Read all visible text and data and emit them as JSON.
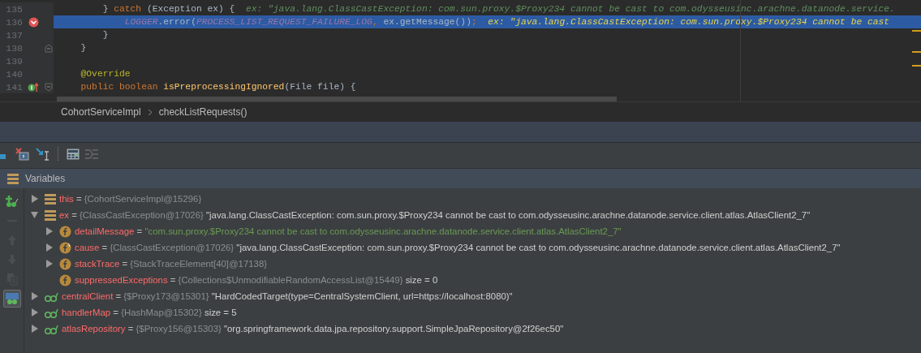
{
  "editor": {
    "lines": [
      {
        "number": "135",
        "kind": "code",
        "breakpoint": false,
        "selected": false,
        "tokens": [
          {
            "text": "      } ",
            "kind": "plain"
          },
          {
            "text": "catch",
            "kind": "keyword"
          },
          {
            "text": " (Exception ex) {",
            "kind": "plain"
          },
          {
            "text": "  ex: \"java.lang.ClassCastException: com.sun.proxy.$Proxy234 cannot be cast to com.odysseusinc.arachne.datanode.service.",
            "kind": "hint"
          }
        ]
      },
      {
        "number": "136",
        "kind": "code",
        "breakpoint": true,
        "selected": true,
        "tokens": [
          {
            "text": "          LOGGER",
            "kind": "static"
          },
          {
            "text": ".error(",
            "kind": "plain"
          },
          {
            "text": "PROCESS_LIST_REQUEST_FAILURE_LOG",
            "kind": "static"
          },
          {
            "text": ", ",
            "kind": "keyword"
          },
          {
            "text": "ex.getMessage())",
            "kind": "plain"
          },
          {
            "text": ";",
            "kind": "keyword"
          },
          {
            "text": "  ex: \"java.lang.ClassCastException: com.sun.proxy.$Proxy234 cannot be cast",
            "kind": "hint"
          }
        ]
      },
      {
        "number": "137",
        "kind": "code",
        "breakpoint": false,
        "selected": false,
        "tokens": [
          {
            "text": "      }",
            "kind": "plain"
          }
        ]
      },
      {
        "number": "138",
        "kind": "block-end",
        "breakpoint": false,
        "selected": false,
        "tokens": [
          {
            "text": "  }",
            "kind": "plain"
          }
        ]
      },
      {
        "number": "139",
        "kind": "code",
        "breakpoint": false,
        "selected": false
      },
      {
        "number": "140",
        "kind": "code",
        "breakpoint": false,
        "selected": false,
        "tokens": [
          {
            "text": "  @Override",
            "kind": "annotation"
          }
        ]
      },
      {
        "number": "141",
        "kind": "method-start",
        "breakpoint": false,
        "selected": false,
        "tokens": [
          {
            "text": "  public boolean ",
            "kind": "keyword"
          },
          {
            "text": "isPreprocessingIgnored",
            "kind": "method"
          },
          {
            "text": "(File file) {",
            "kind": "plain"
          }
        ]
      }
    ]
  },
  "breadcrumbs": [
    "CohortServiceImpl",
    "checkListRequests()"
  ],
  "toolbar": [
    {
      "kind": "step-partial",
      "disabled": false
    },
    {
      "kind": "stop-cross",
      "disabled": false
    },
    {
      "kind": "run-to-cursor",
      "disabled": false
    },
    {
      "kind": "separator"
    },
    {
      "kind": "evaluate",
      "disabled": false
    },
    {
      "kind": "trace",
      "disabled": true
    }
  ],
  "panel": {
    "title": "Variables"
  },
  "side_toolbar": [
    {
      "kind": "new-watch",
      "disabled": false,
      "selected": false
    },
    {
      "kind": "remove",
      "disabled": true,
      "selected": false
    },
    {
      "kind": "up",
      "disabled": true,
      "selected": false
    },
    {
      "kind": "down",
      "disabled": true,
      "selected": false
    },
    {
      "kind": "copy",
      "disabled": true,
      "selected": false
    },
    {
      "kind": "watches",
      "disabled": false,
      "selected": true
    }
  ],
  "variables": [
    {
      "name": "this",
      "kind": "local",
      "op": "=",
      "type": "{CohortServiceImpl@15296}",
      "expanded": false
    },
    {
      "name": "ex",
      "kind": "local",
      "op": "=",
      "type": "{ClassCastException@17026}",
      "value": "\"java.lang.ClassCastException: com.sun.proxy.$Proxy234 cannot be cast to com.odysseusinc.arachne.datanode.service.client.atlas.AtlasClient2_7\"",
      "expanded": true,
      "children": [
        {
          "name": "detailMessage",
          "kind": "field",
          "op": "=",
          "string_value": "\"com.sun.proxy.$Proxy234 cannot be cast to com.odysseusinc.arachne.datanode.service.client.atlas.AtlasClient2_7\"",
          "expanded": false
        },
        {
          "name": "cause",
          "kind": "field-recursive",
          "op": "=",
          "type": "{ClassCastException@17026}",
          "value": "\"java.lang.ClassCastException: com.sun.proxy.$Proxy234 cannot be cast to com.odysseusinc.arachne.datanode.service.client.atlas.AtlasClient2_7\"",
          "expanded": false
        },
        {
          "name": "stackTrace",
          "kind": "field",
          "op": "=",
          "type": "{StackTraceElement[40]@17138}",
          "expanded": false
        },
        {
          "name": "suppressedExceptions",
          "kind": "field",
          "op": "=",
          "type": "{Collections$UnmodifiableRandomAccessList@15449}",
          "value": "size = 0"
        }
      ]
    },
    {
      "name": "centralClient",
      "kind": "watch",
      "op": "=",
      "type": "{$Proxy173@15301}",
      "value": "\"HardCodedTarget(type=CentralSystemClient, url=https://localhost:8080)\"",
      "expanded": false
    },
    {
      "name": "handlerMap",
      "kind": "watch",
      "op": "=",
      "type": "{HashMap@15302}",
      "value": "size = 5",
      "expanded": false
    },
    {
      "name": "atlasRepository",
      "kind": "watch",
      "op": "=",
      "type": "{$Proxy156@15303}",
      "value": "\"org.springframework.data.jpa.repository.support.SimpleJpaRepository@2f26ec50\"",
      "expanded": false
    }
  ]
}
